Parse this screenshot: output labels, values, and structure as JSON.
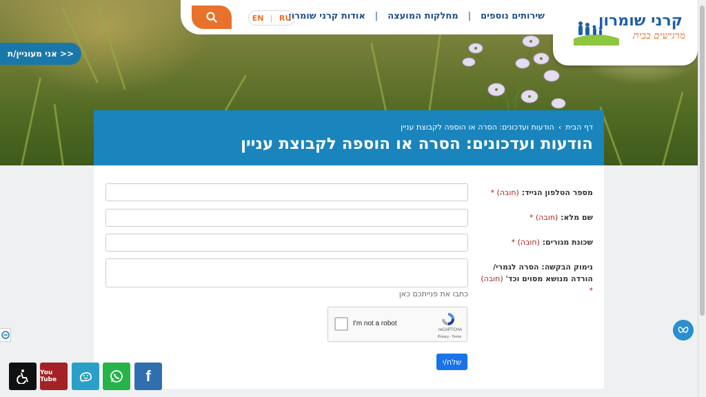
{
  "logo": {
    "title": "קרני שומרון",
    "subtitle": "מרגישים בבית"
  },
  "nav": {
    "items": [
      "אודות קרני שומרון",
      "מחלקות המועצה",
      "שירותים נוספים"
    ],
    "lang": [
      "RU",
      "EN"
    ]
  },
  "interest_tab": "<< אני מעוניין/ת",
  "breadcrumb": {
    "home": "דף הבית",
    "separator": "›",
    "current": "הודעות ועדכונים: הסרה או הוספה לקבוצת עניין"
  },
  "page_title": "הודעות ועדכונים: הסרה או הוספה לקבוצת עניין",
  "form": {
    "phone_label": "מספר הטלפון הנייד:",
    "name_label": "שם מלא:",
    "neighborhood_label": "שכונת מגורים:",
    "reason_label": "נימוק הבקשה: הסרה לגמרי/ הורדה מנושא מסוים וכד'",
    "required": "(חובה) *",
    "hint": "כתבו את פנייתכם כאן",
    "submit": "שלח/י"
  },
  "recaptcha": {
    "label": "I'm not a robot",
    "brand": "reCAPTCHA",
    "terms": "Privacy - Terms"
  },
  "social": [
    {
      "name": "accessibility",
      "color": "#111111"
    },
    {
      "name": "youtube",
      "color": "#a32226",
      "label": "You Tube"
    },
    {
      "name": "waze",
      "color": "#2aa0c8"
    },
    {
      "name": "whatsapp",
      "color": "#25b34a"
    },
    {
      "name": "facebook",
      "color": "#2f6fb0",
      "label": "f"
    }
  ],
  "colors": {
    "primary": "#1a84bd",
    "accent": "#e8712b",
    "nav_text": "#1f4f8a",
    "submit": "#1a73e8"
  }
}
